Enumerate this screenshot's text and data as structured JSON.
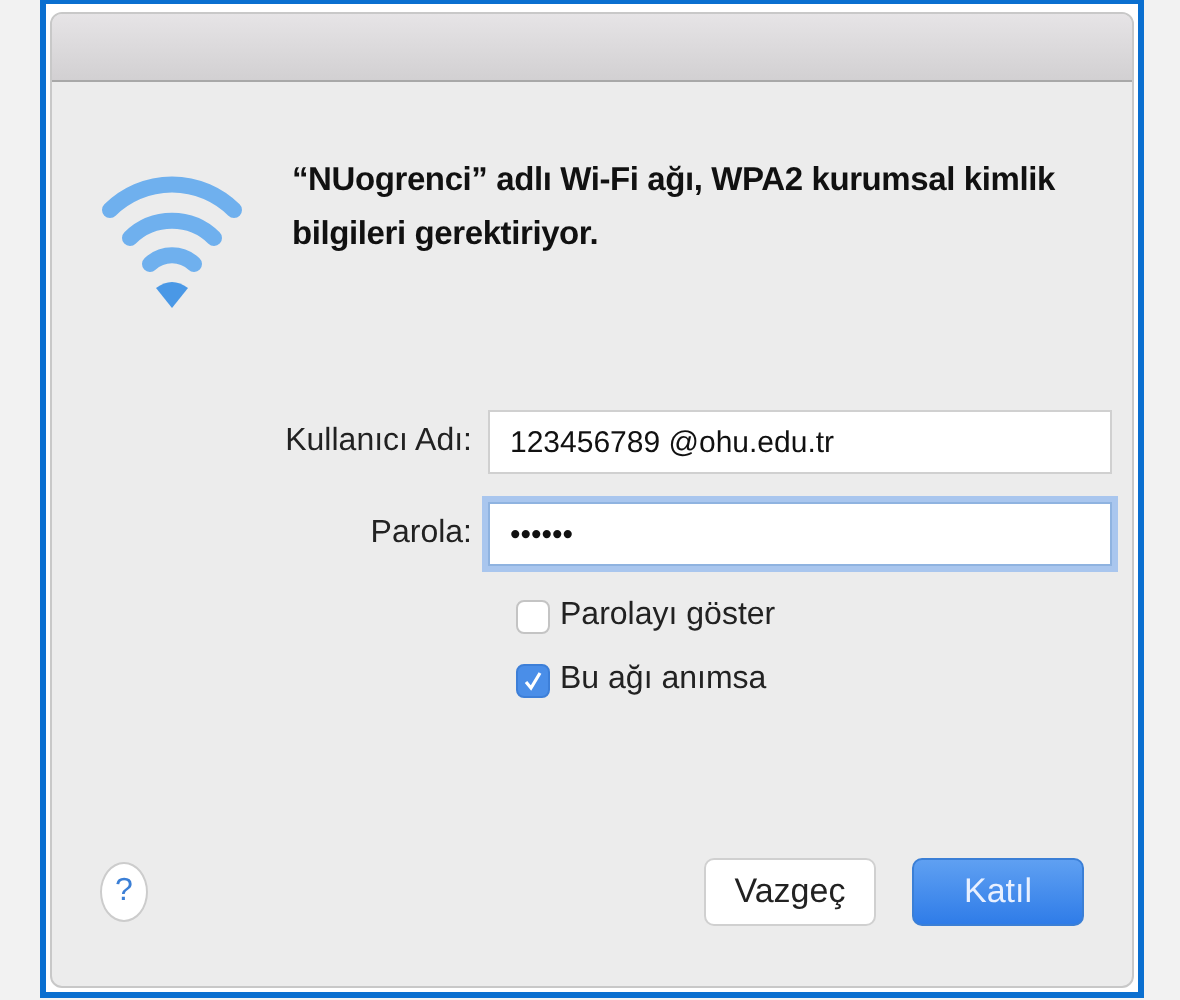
{
  "dialog": {
    "message": "“NUogrenci” adlı Wi-Fi ağı, WPA2 kurumsal kimlik bilgileri gerektiriyor.",
    "fields": [
      {
        "label": "Kullanıcı Adı:",
        "value": "123456789 @ohu.edu.tr",
        "focused": false
      },
      {
        "label": "Parola:",
        "value": "••••••",
        "focused": true
      }
    ],
    "checkboxes": [
      {
        "label": "Parolayı göster",
        "checked": false
      },
      {
        "label": "Bu ağı anımsa",
        "checked": true
      }
    ],
    "help": "?",
    "buttons": [
      {
        "label": "Vazgeç",
        "kind": "secondary"
      },
      {
        "label": "Katıl",
        "kind": "primary"
      }
    ]
  }
}
